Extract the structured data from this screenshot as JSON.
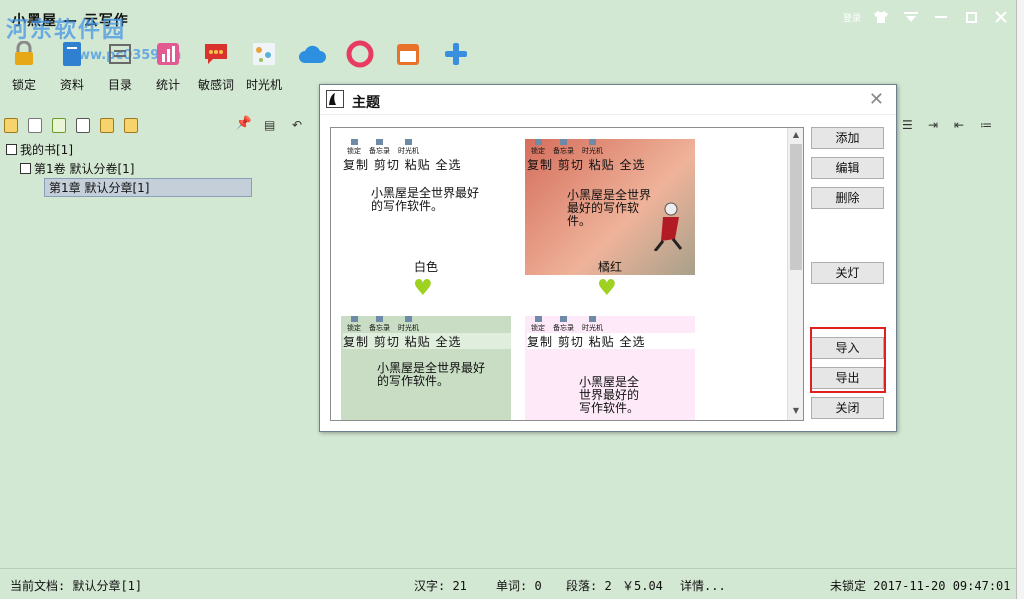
{
  "window": {
    "title": "小黑屋 — 云写作",
    "login": "登录",
    "watermark": "河东软件园",
    "watermark_url": "www.pc0359.cn"
  },
  "toolbar": [
    {
      "label": "锁定",
      "icon": "lock-icon",
      "color": "#e6a817"
    },
    {
      "label": "资料",
      "icon": "book-icon",
      "color": "#2f80d1"
    },
    {
      "label": "目录",
      "icon": "list-icon",
      "color": "#6a6a6a"
    },
    {
      "label": "统计",
      "icon": "stats-icon",
      "color": "#e35a92"
    },
    {
      "label": "敏感词",
      "icon": "chat-icon",
      "color": "#d9322d"
    },
    {
      "label": "时光机",
      "icon": "timemachine-icon",
      "color": "#8fb6d6"
    },
    {
      "label": "云同步",
      "icon": "cloud-icon",
      "color": "#2d8fe0"
    },
    {
      "label": "",
      "icon": "ring-icon",
      "color": "#e83b62"
    },
    {
      "label": "",
      "icon": "calendar-icon",
      "color": "#e8722a"
    },
    {
      "label": "",
      "icon": "plus-icon",
      "color": "#3a8ee0"
    }
  ],
  "tree": {
    "root": "我的书[1]",
    "volume": "第1卷 默认分卷[1]",
    "chapter": "第1章 默认分章[1]"
  },
  "dialog": {
    "title": "主题",
    "buttons": {
      "add": "添加",
      "edit": "编辑",
      "delete": "删除",
      "lights_off": "关灯",
      "import": "导入",
      "export": "导出",
      "close": "关闭"
    },
    "themes": [
      {
        "name": "白色",
        "bg": "#ffffff"
      },
      {
        "name": "橘红",
        "bg": "#e0806a"
      },
      {
        "name": "",
        "bg": "#c8ddc4"
      },
      {
        "name": "",
        "bg": "#fde9f8"
      }
    ],
    "sample": {
      "mini_toolbar": [
        "锁定",
        "备忘录",
        "时光机"
      ],
      "menu": "复制 剪切 粘贴 全选",
      "text_wide": "小黑屋是全世界最好\n的写作软件。",
      "text_narrow": "小黑屋是全\n世界最好的\n写作软件。",
      "text_orange": "小黑屋是全世界\n最好的写作软\n件。"
    }
  },
  "status": {
    "current_doc": "当前文档: 默认分章[1]",
    "chars": "汉字: 21",
    "words": "单词: 0",
    "paragraphs": "段落: 2",
    "price": "￥5.04",
    "details": "详情...",
    "lock_time": "未锁定 2017-11-20 09:47:01"
  }
}
